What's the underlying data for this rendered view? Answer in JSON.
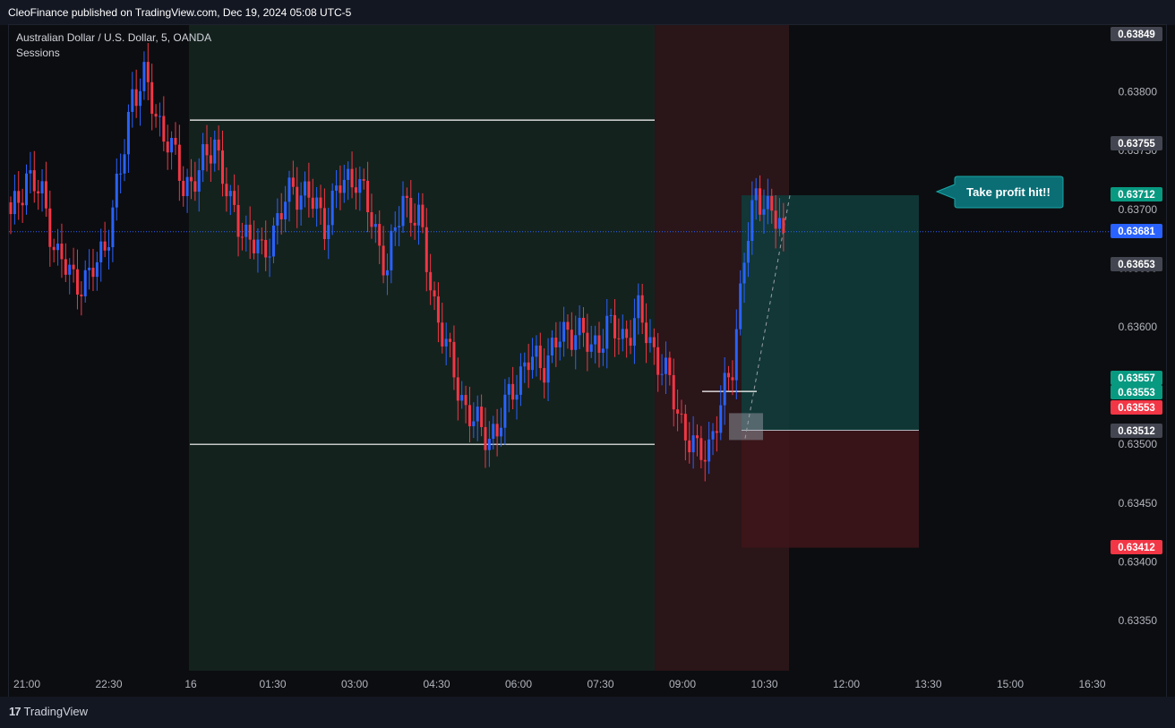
{
  "header": {
    "published": "CleoFinance published on TradingView.com, Dec 19, 2024 05:08 UTC-5"
  },
  "legend": {
    "symbol": "Australian Dollar / U.S. Dollar, 5, OANDA",
    "indicator": "Sessions"
  },
  "branding": {
    "name": "TradingView",
    "mark": "17"
  },
  "annotation": {
    "text": "Take profit hit!!"
  },
  "colors": {
    "up": "#2962ff",
    "down": "#f23645",
    "session_asia": "#14221d",
    "session_london": "#2a1519",
    "tp_zone": "#0f3b3a",
    "sl_zone": "#3d1519"
  },
  "chart_data": {
    "type": "candlestick",
    "timeframe": "5",
    "ylim": [
      0.6331,
      0.6386
    ],
    "x_ticks": [
      "21:00",
      "22:30",
      "16",
      "01:30",
      "03:00",
      "04:30",
      "06:00",
      "07:30",
      "09:00",
      "10:30",
      "12:00",
      "13:30",
      "15:00",
      "16:30"
    ],
    "y_ticks": [
      0.638,
      0.6375,
      0.637,
      0.6365,
      0.636,
      0.6355,
      0.635,
      0.6345,
      0.634,
      0.6335
    ],
    "y_tick_labels": [
      "0.63800",
      "0.63750",
      "0.63700",
      "0.63650",
      "0.63600",
      "0.63550",
      "0.63500",
      "0.63450",
      "0.63400",
      "0.63350"
    ],
    "price_tags": [
      {
        "label": "0.63849",
        "value": 0.63849,
        "color": "#434651"
      },
      {
        "label": "0.63755",
        "value": 0.63755,
        "color": "#434651"
      },
      {
        "label": "0.63712",
        "value": 0.63712,
        "color": "#089981"
      },
      {
        "label": "0.63681",
        "value": 0.63681,
        "color": "#2962ff"
      },
      {
        "label": "0.63653",
        "value": 0.63653,
        "color": "#434651"
      },
      {
        "label": "0.63557",
        "value": 0.63557,
        "color": "#089981"
      },
      {
        "label": "0.63553",
        "value": 0.63553,
        "color": "#089981"
      },
      {
        "label": "0.63553",
        "value": 0.63553,
        "color": "#f23645"
      },
      {
        "label": "0.63512",
        "value": 0.63512,
        "color": "#434651"
      },
      {
        "label": "0.63412",
        "value": 0.63412,
        "color": "#f23645"
      }
    ],
    "current_price": 0.63681,
    "position": {
      "entry": 0.63512,
      "take_profit": 0.63712,
      "stop_loss": 0.63412
    },
    "asia_range": {
      "high": 0.63776,
      "low": 0.635
    },
    "breakout_level": 0.63545,
    "candle_anchors": [
      [
        0,
        0.6369
      ],
      [
        4,
        0.6373
      ],
      [
        8,
        0.6371
      ],
      [
        12,
        0.6366
      ],
      [
        16,
        0.6364
      ],
      [
        20,
        0.6364
      ],
      [
        24,
        0.6367
      ],
      [
        28,
        0.6373
      ],
      [
        31,
        0.638
      ],
      [
        34,
        0.6381
      ],
      [
        37,
        0.6378
      ],
      [
        40,
        0.6376
      ],
      [
        44,
        0.6372
      ],
      [
        48,
        0.6373
      ],
      [
        52,
        0.6376
      ],
      [
        56,
        0.637
      ],
      [
        60,
        0.6368
      ],
      [
        64,
        0.6366
      ],
      [
        68,
        0.6369
      ],
      [
        72,
        0.6372
      ],
      [
        76,
        0.6371
      ],
      [
        80,
        0.6369
      ],
      [
        84,
        0.6372
      ],
      [
        88,
        0.6373
      ],
      [
        92,
        0.6369
      ],
      [
        96,
        0.6365
      ],
      [
        100,
        0.6371
      ],
      [
        104,
        0.6369
      ],
      [
        108,
        0.6362
      ],
      [
        112,
        0.6357
      ],
      [
        116,
        0.6353
      ],
      [
        120,
        0.6351
      ],
      [
        124,
        0.6351
      ],
      [
        128,
        0.6355
      ],
      [
        132,
        0.6357
      ],
      [
        136,
        0.6357
      ],
      [
        140,
        0.6359
      ],
      [
        144,
        0.636
      ],
      [
        148,
        0.6358
      ],
      [
        152,
        0.636
      ],
      [
        156,
        0.6359
      ],
      [
        160,
        0.6361
      ],
      [
        164,
        0.6358
      ],
      [
        168,
        0.6355
      ],
      [
        172,
        0.6351
      ],
      [
        175,
        0.6349
      ],
      [
        178,
        0.635
      ],
      [
        181,
        0.6353
      ],
      [
        184,
        0.6357
      ],
      [
        187,
        0.6366
      ],
      [
        190,
        0.6371
      ],
      [
        192,
        0.6371
      ],
      [
        195,
        0.6369
      ],
      [
        197,
        0.6368
      ]
    ]
  }
}
